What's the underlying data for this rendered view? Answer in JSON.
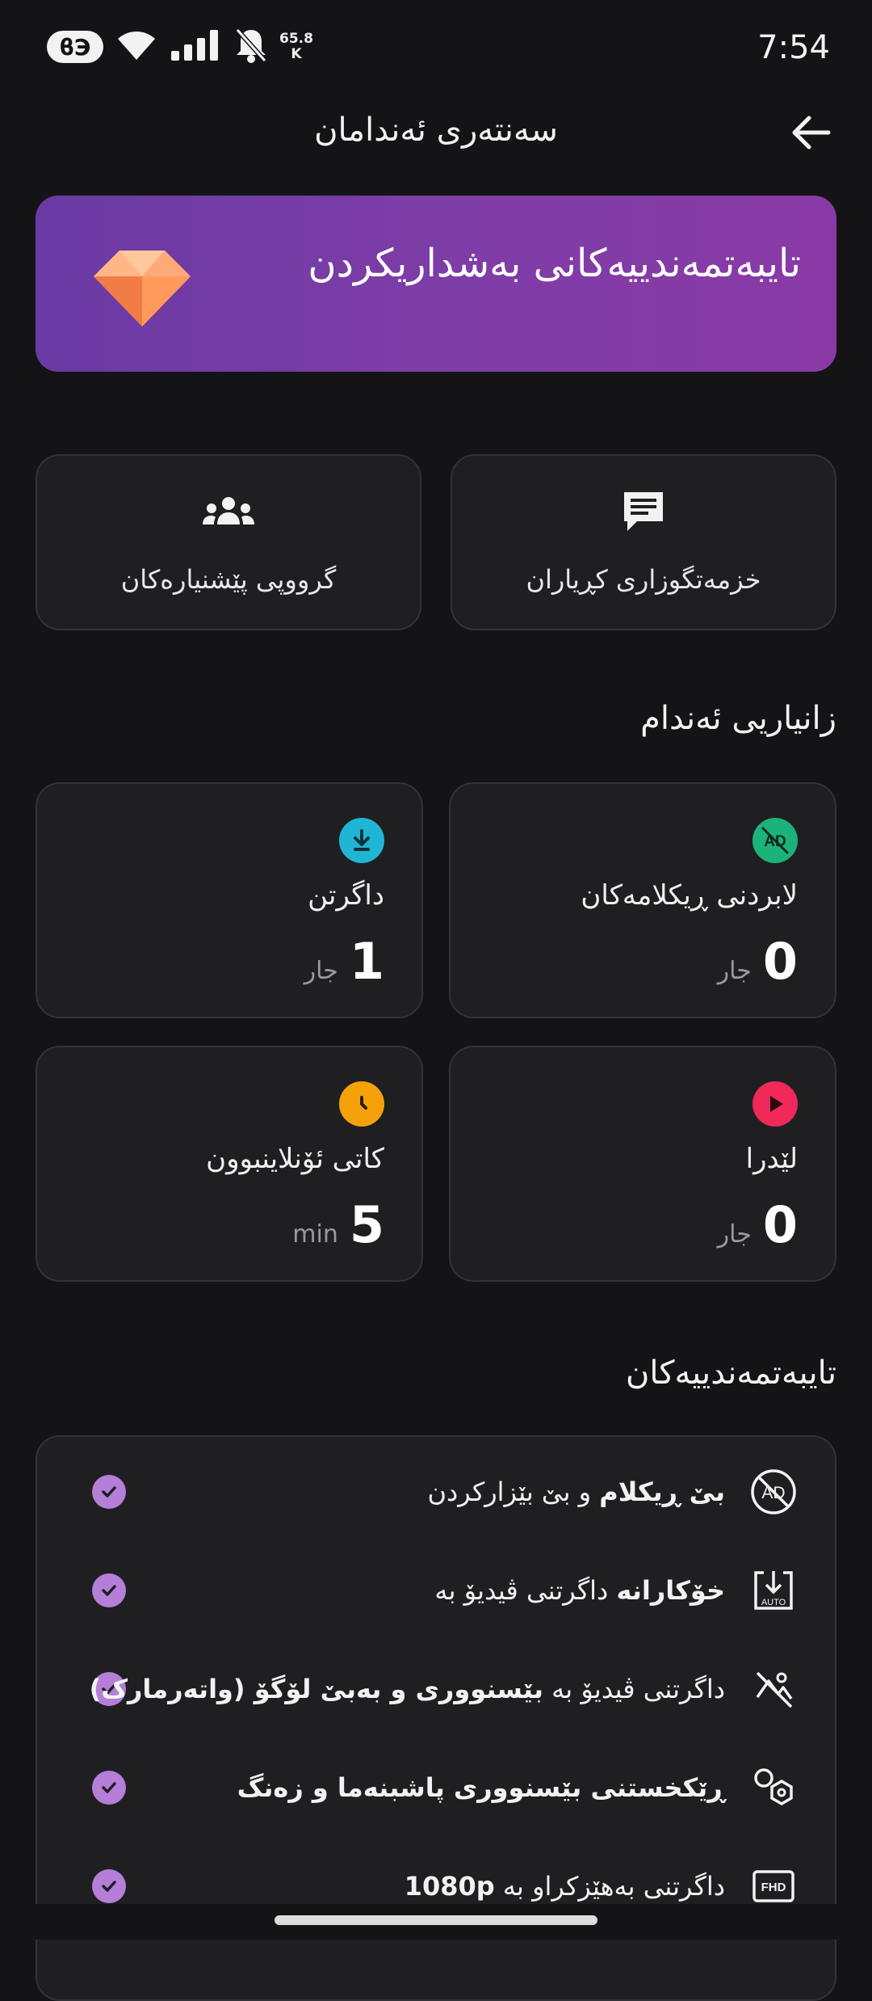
{
  "status_bar": {
    "time": "7:54",
    "sim_badge": "ϐЭ",
    "net_speed_value": "65.8",
    "net_speed_unit": "K",
    "icons": [
      "wifi-icon",
      "signal-icon",
      "mute-bell-icon"
    ]
  },
  "header": {
    "title": "سەنتەری ئەندامان",
    "back_icon": "arrow-back-icon"
  },
  "banner": {
    "title": "تایبەتمەندییەکانی بەشداریکردن",
    "icon": "diamond-icon"
  },
  "quick_links": [
    {
      "label": "خزمەتگوزاری کڕیاران",
      "icon": "chat-icon"
    },
    {
      "label": "گرووپی پێشنیارەکان",
      "icon": "group-icon"
    }
  ],
  "member_info": {
    "title": "زانیاریی ئەندام",
    "stats": [
      {
        "label": "لابردنی ڕیکلامەکان",
        "value": "0",
        "unit": "جار",
        "icon": "ad-off-icon",
        "color": "#1bb37a"
      },
      {
        "label": "داگرتن",
        "value": "1",
        "unit": "جار",
        "icon": "download-icon",
        "color": "#1fb6d6"
      },
      {
        "label": "لێدرا",
        "value": "0",
        "unit": "جار",
        "icon": "play-icon",
        "color": "#f0295a"
      },
      {
        "label": "کاتی ئۆنلاینبوون",
        "value": "5",
        "unit": "min",
        "icon": "clock-icon",
        "color": "#f5a20a"
      }
    ]
  },
  "features": {
    "title": "تایبەتمەندییەکان",
    "items": [
      {
        "plain": "و بێ بێزارکردن",
        "bold": "بێ ڕیکلام",
        "icon": "no-ads-icon"
      },
      {
        "plain": "داگرتنی ڤیدیۆ بە",
        "bold": "خۆکارانە",
        "icon": "auto-download-icon"
      },
      {
        "plain": "داگرتنی ڤیدیۆ بە",
        "bold": "بێسنووری و بەبێ لۆگۆ (واتەرمارک)",
        "icon": "no-watermark-icon"
      },
      {
        "plain": "",
        "bold": "ڕێکخستنی بێسنووری پاشبنەما و زەنگ",
        "icon": "customize-icon"
      },
      {
        "plain": "داگرتنی بەهێزکراو بە",
        "bold": "1080p",
        "icon": "fhd-icon"
      }
    ]
  },
  "colors": {
    "background": "#141416",
    "card": "#1f1f22",
    "check": "#b57ed8",
    "banner_start": "#6a3aa4",
    "banner_end": "#8a3aa6"
  }
}
